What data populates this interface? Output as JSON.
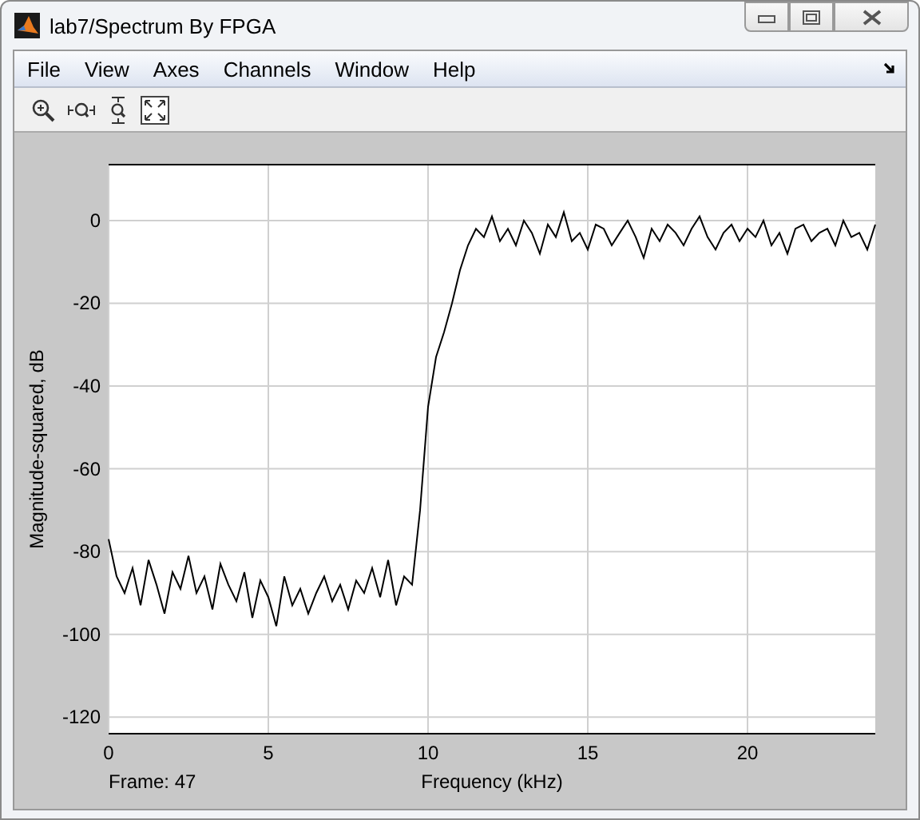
{
  "window": {
    "title": "lab7/Spectrum By FPGA"
  },
  "menu": [
    "File",
    "View",
    "Axes",
    "Channels",
    "Window",
    "Help"
  ],
  "figure": {
    "frame_label": "Frame: 47",
    "chart_data": {
      "type": "line",
      "grid": true,
      "xlabel": "Frequency (kHz)",
      "ylabel": "Magnitude-squared, dB",
      "xlim": [
        0,
        24
      ],
      "ylim": [
        -124,
        13.5
      ],
      "xticks": [
        0,
        5,
        10,
        15,
        20
      ],
      "yticks": [
        0,
        -20,
        -40,
        -60,
        -80,
        -100,
        -120
      ],
      "x": [
        0,
        0.25,
        0.5,
        0.75,
        1,
        1.25,
        1.5,
        1.75,
        2,
        2.25,
        2.5,
        2.75,
        3,
        3.25,
        3.5,
        3.75,
        4,
        4.25,
        4.5,
        4.75,
        5,
        5.25,
        5.5,
        5.75,
        6,
        6.25,
        6.5,
        6.75,
        7,
        7.25,
        7.5,
        7.75,
        8,
        8.25,
        8.5,
        8.75,
        9,
        9.25,
        9.5,
        9.75,
        10,
        10.25,
        10.5,
        10.75,
        11,
        11.25,
        11.5,
        11.75,
        12,
        12.25,
        12.5,
        12.75,
        13,
        13.25,
        13.5,
        13.75,
        14,
        14.25,
        14.5,
        14.75,
        15,
        15.25,
        15.5,
        15.75,
        16,
        16.25,
        16.5,
        16.75,
        17,
        17.25,
        17.5,
        17.75,
        18,
        18.25,
        18.5,
        18.75,
        19,
        19.25,
        19.5,
        19.75,
        20,
        20.25,
        20.5,
        20.75,
        21,
        21.25,
        21.5,
        21.75,
        22,
        22.25,
        22.5,
        22.75,
        23,
        23.25,
        23.5,
        23.75,
        24
      ],
      "series": [
        {
          "color": "#000000",
          "values": [
            -77,
            -86,
            -90,
            -84,
            -93,
            -82,
            -88,
            -95,
            -85,
            -89,
            -81,
            -90,
            -86,
            -94,
            -83,
            -88,
            -92,
            -85,
            -96,
            -87,
            -91,
            -98,
            -86,
            -93,
            -89,
            -95,
            -90,
            -86,
            -92,
            -88,
            -94,
            -87,
            -90,
            -84,
            -91,
            -82,
            -93,
            -86,
            -88,
            -70,
            -45,
            -33,
            -27,
            -20,
            -12,
            -6,
            -2,
            -4,
            1,
            -5,
            -2,
            -6,
            0,
            -3,
            -8,
            -1,
            -4,
            2,
            -5,
            -3,
            -7,
            -1,
            -2,
            -6,
            -3,
            0,
            -4,
            -9,
            -2,
            -5,
            -1,
            -3,
            -6,
            -2,
            1,
            -4,
            -7,
            -3,
            -1,
            -5,
            -2,
            -4,
            0,
            -6,
            -3,
            -8,
            -2,
            -1,
            -5,
            -3,
            -2,
            -6,
            0,
            -4,
            -3,
            -7,
            -1
          ]
        }
      ]
    }
  }
}
